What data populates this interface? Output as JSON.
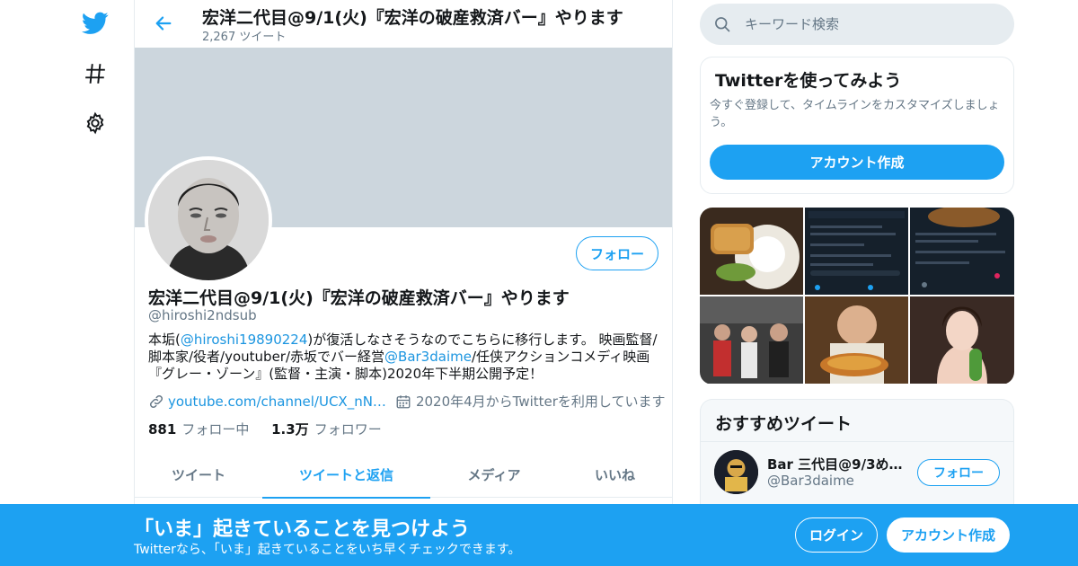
{
  "colors": {
    "accent": "#1da1f2",
    "link": "#1b95e0",
    "muted": "#657786",
    "text": "#14171a",
    "banner": "#ccd6dd"
  },
  "nav": {
    "icons": [
      "twitter-logo-icon",
      "hashtag-icon",
      "gear-icon"
    ]
  },
  "header": {
    "title": "宏洋二代目@9/1(火)『宏洋の破産救済バー』やります",
    "tweet_count": "2,267 ツイート"
  },
  "profile": {
    "follow_label": "フォロー",
    "name": "宏洋二代目@9/1(火)『宏洋の破産救済バー』やります",
    "handle": "@hiroshi2ndsub",
    "bio": {
      "p1": "本垢(",
      "link1": "@hiroshi19890224",
      "p2": ")が復活しなさそうなのでこちらに移行します。 映画監督/脚本家/役者/youtuber/赤坂でバー経営",
      "link2": "@Bar3daime",
      "p3": "/任侠アクションコメディ映画『グレー・ゾーン』(監督・主演・脚本)2020年下半期公開予定！"
    },
    "website": "youtube.com/channel/UCX_nN…",
    "joined": "2020年4月からTwitterを利用しています",
    "following_count": "881",
    "following_label": "フォロー中",
    "followers_count": "1.3万",
    "followers_label": "フォロワー"
  },
  "tabs": [
    {
      "label": "ツイート",
      "active": false
    },
    {
      "label": "ツイートと返信",
      "active": true
    },
    {
      "label": "メディア",
      "active": false
    },
    {
      "label": "いいね",
      "active": false
    }
  ],
  "search": {
    "placeholder": "キーワード検索"
  },
  "signup_card": {
    "title": "Twitterを使ってみよう",
    "description": "今すぐ登録して、タイムラインをカスタマイズしましょう。",
    "button": "アカウント作成"
  },
  "recommended": {
    "title": "おすすめツイート",
    "user": {
      "name": "Bar 三代目@9/3めり…",
      "handle": "@Bar3daime",
      "follow_label": "フォロー"
    }
  },
  "bottom_bar": {
    "title": "「いま」起きていることを見つけよう",
    "subtitle": "Twitterなら、「いま」起きていることをいち早くチェックできます。",
    "login": "ログイン",
    "signup": "アカウント作成"
  }
}
